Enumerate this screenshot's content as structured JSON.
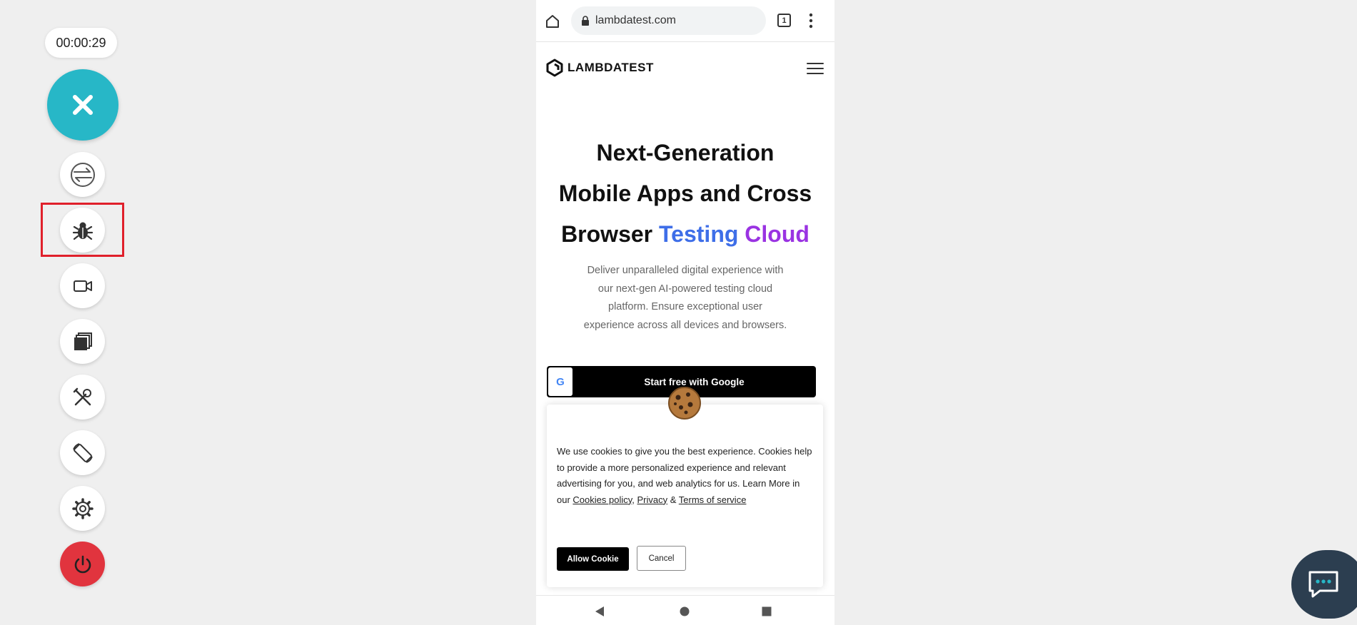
{
  "session": {
    "timer": "00:00:29"
  },
  "toolbar": {
    "tools": [
      {
        "icon": "switch-arrows-icon"
      },
      {
        "icon": "bug-icon"
      },
      {
        "icon": "video-camera-icon"
      },
      {
        "icon": "screenshots-gallery-icon"
      },
      {
        "icon": "tools-icon"
      },
      {
        "icon": "rotate-device-icon"
      },
      {
        "icon": "gear-icon"
      },
      {
        "icon": "power-icon"
      }
    ]
  },
  "browser": {
    "url": "lambdatest.com",
    "tab_count": "1"
  },
  "site": {
    "logo_text": "LAMBDATEST",
    "hero_line1": "Next-Generation",
    "hero_line2": "Mobile Apps and Cross",
    "hero_line3_prefix": "Browser ",
    "hero_word_blue": "Testing",
    "hero_word_purple": "Cloud",
    "subtitle": "Deliver unparalleled digital experience with our next-gen AI-powered testing cloud platform. Ensure exceptional user experience across all devices and browsers.",
    "google_button": "Start free with Google",
    "google_letter": "G"
  },
  "cookie": {
    "text_before": "We use cookies to give you the best experience. Cookies help to provide a more personalized experience and relevant advertising for you, and web analytics for us. Learn More in our ",
    "link_cookies": "Cookies policy",
    "sep1": ", ",
    "link_privacy": "Privacy",
    "sep2": " & ",
    "link_terms": "Terms of service",
    "allow_label": "Allow Cookie",
    "cancel_label": "Cancel"
  },
  "colors": {
    "accent_teal": "#27b7c7",
    "power_red": "#e1343e",
    "highlight_red": "#e0202b",
    "hero_blue": "#3e6ee8",
    "hero_purple": "#9a33e2",
    "chat_bg": "#2c3e50"
  }
}
